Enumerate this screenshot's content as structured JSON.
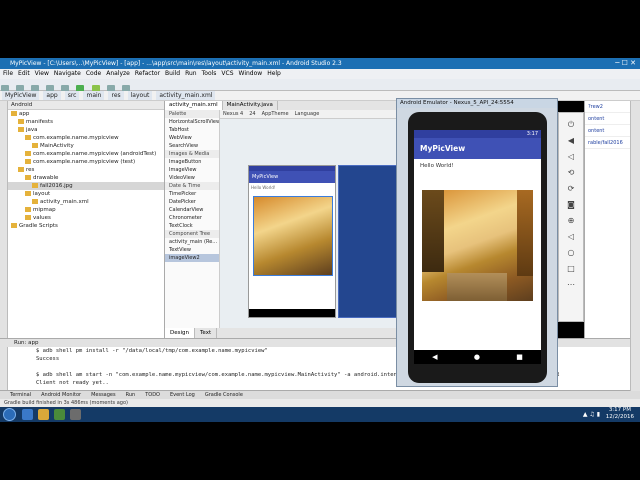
{
  "window": {
    "title": "MyPicView - [C:\\Users\\...\\MyPicView] - [app] - ...\\app\\src\\main\\res\\layout\\activity_main.xml - Android Studio 2.3"
  },
  "menu": [
    "File",
    "Edit",
    "View",
    "Navigate",
    "Code",
    "Analyze",
    "Refactor",
    "Build",
    "Run",
    "Tools",
    "VCS",
    "Window",
    "Help"
  ],
  "nav": {
    "items": [
      "MyPicView",
      "app",
      "src",
      "main",
      "res",
      "layout",
      "activity_main.xml"
    ]
  },
  "project": {
    "header": "Android",
    "tree": [
      {
        "label": "app",
        "sel": false
      },
      {
        "label": "manifests",
        "sel": false
      },
      {
        "label": "java",
        "sel": false
      },
      {
        "label": "com.example.name.mypicview",
        "sel": false
      },
      {
        "label": "MainActivity",
        "sel": false
      },
      {
        "label": "com.example.name.mypicview (androidTest)",
        "sel": false
      },
      {
        "label": "com.example.name.mypicview (test)",
        "sel": false
      },
      {
        "label": "res",
        "sel": false
      },
      {
        "label": "drawable",
        "sel": false
      },
      {
        "label": "fall2016.jpg",
        "sel": true
      },
      {
        "label": "layout",
        "sel": false
      },
      {
        "label": "activity_main.xml",
        "sel": false
      },
      {
        "label": "mipmap",
        "sel": false
      },
      {
        "label": "values",
        "sel": false
      },
      {
        "label": "Gradle Scripts",
        "sel": false
      }
    ]
  },
  "editor": {
    "tabs": [
      "activity_main.xml",
      "MainActivity.java"
    ],
    "palette_header": "Palette",
    "palette": [
      {
        "label": "HorizontalScrollView",
        "cat": false
      },
      {
        "label": "TabHost",
        "cat": false
      },
      {
        "label": "WebView",
        "cat": false
      },
      {
        "label": "SearchView",
        "cat": false
      },
      {
        "label": "Images & Media",
        "cat": true
      },
      {
        "label": "ImageButton",
        "cat": false
      },
      {
        "label": "ImageView",
        "cat": false
      },
      {
        "label": "VideoView",
        "cat": false
      },
      {
        "label": "Date & Time",
        "cat": true
      },
      {
        "label": "TimePicker",
        "cat": false
      },
      {
        "label": "DatePicker",
        "cat": false
      },
      {
        "label": "CalendarView",
        "cat": false
      },
      {
        "label": "Chronometer",
        "cat": false
      },
      {
        "label": "TextClock",
        "cat": false
      },
      {
        "label": "Component Tree",
        "cat": true
      },
      {
        "label": "activity_main (Re...",
        "cat": false
      },
      {
        "label": "TextView",
        "cat": false
      },
      {
        "label": "imageView2",
        "cat": false
      }
    ],
    "design_toolbar": [
      "Nexus 4",
      "24",
      "AppTheme",
      "Language"
    ],
    "preview_app": "MyPicView",
    "preview_text": "Hello World!",
    "bottom_tabs": [
      "Design",
      "Text"
    ]
  },
  "run": {
    "header": "Run: app",
    "console": [
      "$ adb shell pm install -r \"/data/local/tmp/com.example.name.mypicview\"",
      "Success",
      "",
      "$ adb shell am start -n \"com.example.name.mypicview/com.example.name.mypicview.MainActivity\" -a android.intent.action.MAIN -c android.intent.category.LAUNCHER",
      "Client not ready yet.."
    ]
  },
  "bottombar": [
    "Terminal",
    "Android Monitor",
    "Messages",
    "Run",
    "TODO",
    "Event Log",
    "Gradle Console"
  ],
  "status": "Gradle build finished in 3s 486ms (moments ago)",
  "emulator": {
    "title": "Android Emulator - Nexus_5_API_24:5554",
    "time": "3:17",
    "app_title": "MyPicView",
    "hello": "Hello World!"
  },
  "props": [
    "?rew2",
    "ontent",
    "ontent",
    "rable/fall2016"
  ],
  "clock": {
    "time": "3:17 PM",
    "date": "12/2/2016"
  }
}
